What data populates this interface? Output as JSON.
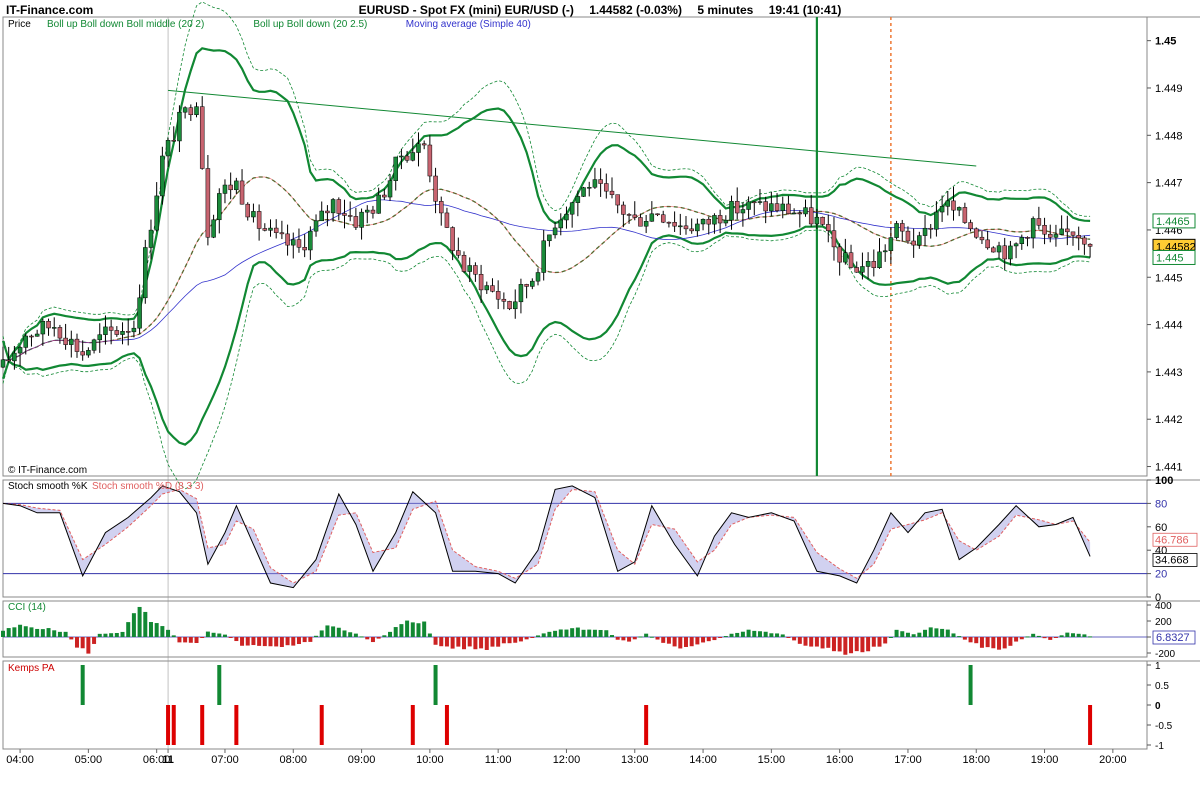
{
  "header": {
    "brand": "IT-Finance.com",
    "instrument": "EURUSD - Spot FX (mini) EUR/USD (-)",
    "price_change": "1.44582 (-0.03%)",
    "interval": "5 minutes",
    "time": "19:41 (10:41)"
  },
  "price_panel": {
    "legend": [
      {
        "text": "Price",
        "color": "#000000"
      },
      {
        "text": "Boll up Boll down Boll middle (20 2)",
        "color": "#118833"
      },
      {
        "text": "Boll up Boll down (20 2.5)",
        "color": "#118833"
      },
      {
        "text": "Moving average (Simple 40)",
        "color": "#3333cc"
      }
    ],
    "watermark": "© IT-Finance.com",
    "y_ticks": [
      "1.45",
      "1.449",
      "1.448",
      "1.447",
      "1.446",
      "1.445",
      "1.444",
      "1.443",
      "1.442",
      "1.441"
    ],
    "badges": [
      {
        "text": "1.4465",
        "color": "#118833",
        "bg": "#ffffff"
      },
      {
        "text": "1.44582",
        "color": "#000000",
        "bg": "#ffcc33"
      },
      {
        "text": "1.445",
        "color": "#118833",
        "bg": "#ffffff"
      }
    ]
  },
  "stoch_panel": {
    "legend": [
      {
        "text": "Stoch smooth %K",
        "color": "#000000"
      },
      {
        "text": "Stoch smooth %D (8 3 3)",
        "color": "#e06060"
      }
    ],
    "y_ticks": [
      "100",
      "80",
      "60",
      "40",
      "20",
      "0"
    ],
    "badges": [
      "46.786",
      "34.668"
    ]
  },
  "cci_panel": {
    "legend": [
      {
        "text": "CCI (14)",
        "color": "#118833"
      }
    ],
    "y_ticks": [
      "400",
      "200",
      "0",
      "-200"
    ],
    "badges": [
      "6.8327"
    ]
  },
  "kemps_panel": {
    "legend": [
      {
        "text": "Kemps PA",
        "color": "#cc0000"
      }
    ],
    "y_ticks": [
      "1",
      "0.5",
      "0",
      "-0.5",
      "-1"
    ]
  },
  "x_ticks": [
    "04:00",
    "05:00",
    "06:00",
    "11",
    "07:00",
    "08:00",
    "09:00",
    "10:00",
    "11:00",
    "12:00",
    "13:00",
    "14:00",
    "15:00",
    "16:00",
    "17:00",
    "18:00",
    "19:00",
    "20:00"
  ],
  "colors": {
    "bull": "#1a8a3a",
    "bear": "#c86470",
    "boll": "#118833",
    "ma": "#3333cc",
    "red_line": "#dd2222",
    "cci_up": "#118833",
    "cci_down": "#cc2222",
    "kemps_up": "#118833",
    "kemps_down": "#dd0000"
  },
  "chart_data": [
    {
      "type": "candlestick",
      "title": "Price",
      "ylim": [
        1.4408,
        1.4505
      ],
      "x_range": [
        "03:45",
        "20:30"
      ],
      "annotations": [
        {
          "type": "trendline",
          "from": [
            "06:10",
            1.44895
          ],
          "to": [
            "18:00",
            1.44735
          ]
        },
        {
          "type": "vline",
          "x": "15:40",
          "style": "solid",
          "color": "#118833"
        },
        {
          "type": "vline",
          "x": "16:45",
          "style": "dotted",
          "color": "#ee7733"
        },
        {
          "type": "vline",
          "x": "06:10",
          "style": "thin",
          "color": "#999999"
        }
      ],
      "close_path": [
        [
          "03:45",
          1.4431
        ],
        [
          "04:05",
          1.4438
        ],
        [
          "04:30",
          1.444
        ],
        [
          "04:55",
          1.4434
        ],
        [
          "05:15",
          1.4438
        ],
        [
          "05:40",
          1.444
        ],
        [
          "05:50",
          1.4455
        ],
        [
          "06:05",
          1.4475
        ],
        [
          "06:20",
          1.4483
        ],
        [
          "06:35",
          1.4488
        ],
        [
          "06:45",
          1.446
        ],
        [
          "06:55",
          1.4468
        ],
        [
          "07:10",
          1.447
        ],
        [
          "07:25",
          1.4462
        ],
        [
          "07:45",
          1.4458
        ],
        [
          "08:05",
          1.4456
        ],
        [
          "08:20",
          1.4461
        ],
        [
          "08:35",
          1.4466
        ],
        [
          "08:55",
          1.4462
        ],
        [
          "09:15",
          1.4466
        ],
        [
          "09:35",
          1.4476
        ],
        [
          "09:55",
          1.4478
        ],
        [
          "10:10",
          1.4462
        ],
        [
          "10:30",
          1.4452
        ],
        [
          "10:50",
          1.4448
        ],
        [
          "11:10",
          1.4444
        ],
        [
          "11:30",
          1.445
        ],
        [
          "11:50",
          1.4462
        ],
        [
          "12:05",
          1.4466
        ],
        [
          "12:20",
          1.447
        ],
        [
          "12:40",
          1.4466
        ],
        [
          "13:00",
          1.4462
        ],
        [
          "13:20",
          1.4464
        ],
        [
          "13:40",
          1.4461
        ],
        [
          "14:00",
          1.4461
        ],
        [
          "14:20",
          1.4464
        ],
        [
          "14:40",
          1.4465
        ],
        [
          "15:00",
          1.4465
        ],
        [
          "15:20",
          1.4464
        ],
        [
          "15:40",
          1.4462
        ],
        [
          "15:55",
          1.4456
        ],
        [
          "16:10",
          1.4452
        ],
        [
          "16:30",
          1.4453
        ],
        [
          "16:50",
          1.446
        ],
        [
          "17:10",
          1.4457
        ],
        [
          "17:30",
          1.4466
        ],
        [
          "17:50",
          1.4462
        ],
        [
          "18:10",
          1.4458
        ],
        [
          "18:30",
          1.4455
        ],
        [
          "18:50",
          1.4462
        ],
        [
          "19:05",
          1.4457
        ],
        [
          "19:25",
          1.446
        ],
        [
          "19:40",
          1.44582
        ]
      ],
      "series": [
        {
          "name": "Boll up",
          "style": "thick"
        },
        {
          "name": "Boll down",
          "style": "thick"
        },
        {
          "name": "Boll middle",
          "style": "dashed"
        },
        {
          "name": "Moving average (Simple 40)",
          "style": "thin"
        }
      ]
    },
    {
      "type": "line",
      "title": "Stoch smooth %K / %D (8 3 3)",
      "ylim": [
        0,
        100
      ],
      "reference_lines": [
        80,
        20
      ],
      "series": [
        {
          "name": "Stoch smooth %K",
          "points": [
            [
              "03:45",
              80
            ],
            [
              "04:00",
              78
            ],
            [
              "04:15",
              72
            ],
            [
              "04:35",
              72
            ],
            [
              "04:55",
              18
            ],
            [
              "05:15",
              55
            ],
            [
              "05:35",
              68
            ],
            [
              "05:55",
              85
            ],
            [
              "06:05",
              95
            ],
            [
              "06:20",
              90
            ],
            [
              "06:35",
              72
            ],
            [
              "06:45",
              28
            ],
            [
              "07:00",
              55
            ],
            [
              "07:10",
              78
            ],
            [
              "07:25",
              45
            ],
            [
              "07:40",
              12
            ],
            [
              "08:00",
              8
            ],
            [
              "08:20",
              32
            ],
            [
              "08:40",
              88
            ],
            [
              "08:55",
              62
            ],
            [
              "09:10",
              22
            ],
            [
              "09:30",
              55
            ],
            [
              "09:45",
              90
            ],
            [
              "10:05",
              72
            ],
            [
              "10:20",
              22
            ],
            [
              "10:40",
              22
            ],
            [
              "11:00",
              20
            ],
            [
              "11:15",
              12
            ],
            [
              "11:35",
              40
            ],
            [
              "11:50",
              92
            ],
            [
              "12:05",
              95
            ],
            [
              "12:25",
              85
            ],
            [
              "12:45",
              22
            ],
            [
              "13:00",
              30
            ],
            [
              "13:15",
              78
            ],
            [
              "13:35",
              45
            ],
            [
              "13:55",
              18
            ],
            [
              "14:10",
              52
            ],
            [
              "14:25",
              72
            ],
            [
              "14:40",
              68
            ],
            [
              "15:00",
              72
            ],
            [
              "15:20",
              65
            ],
            [
              "15:40",
              22
            ],
            [
              "16:00",
              18
            ],
            [
              "16:15",
              12
            ],
            [
              "16:30",
              40
            ],
            [
              "16:45",
              72
            ],
            [
              "17:00",
              55
            ],
            [
              "17:15",
              72
            ],
            [
              "17:30",
              75
            ],
            [
              "17:45",
              32
            ],
            [
              "18:00",
              42
            ],
            [
              "18:20",
              62
            ],
            [
              "18:35",
              78
            ],
            [
              "18:55",
              60
            ],
            [
              "19:10",
              62
            ],
            [
              "19:25",
              68
            ],
            [
              "19:40",
              34.668
            ]
          ]
        },
        {
          "name": "Stoch smooth %D",
          "points": [
            [
              "03:45",
              80
            ],
            [
              "04:00",
              79
            ],
            [
              "04:15",
              76
            ],
            [
              "04:35",
              74
            ],
            [
              "04:55",
              32
            ],
            [
              "05:15",
              45
            ],
            [
              "05:35",
              60
            ],
            [
              "05:55",
              78
            ],
            [
              "06:05",
              88
            ],
            [
              "06:20",
              92
            ],
            [
              "06:35",
              84
            ],
            [
              "06:45",
              42
            ],
            [
              "07:00",
              45
            ],
            [
              "07:10",
              65
            ],
            [
              "07:25",
              58
            ],
            [
              "07:40",
              25
            ],
            [
              "08:00",
              12
            ],
            [
              "08:20",
              22
            ],
            [
              "08:40",
              70
            ],
            [
              "08:55",
              72
            ],
            [
              "09:10",
              38
            ],
            [
              "09:30",
              42
            ],
            [
              "09:45",
              75
            ],
            [
              "10:05",
              82
            ],
            [
              "10:20",
              40
            ],
            [
              "10:40",
              26
            ],
            [
              "11:00",
              22
            ],
            [
              "11:15",
              16
            ],
            [
              "11:35",
              28
            ],
            [
              "11:50",
              75
            ],
            [
              "12:05",
              92
            ],
            [
              "12:25",
              90
            ],
            [
              "12:45",
              40
            ],
            [
              "13:00",
              28
            ],
            [
              "13:15",
              62
            ],
            [
              "13:35",
              58
            ],
            [
              "13:55",
              30
            ],
            [
              "14:10",
              40
            ],
            [
              "14:25",
              62
            ],
            [
              "14:40",
              68
            ],
            [
              "15:00",
              70
            ],
            [
              "15:20",
              68
            ],
            [
              "15:40",
              38
            ],
            [
              "16:00",
              24
            ],
            [
              "16:15",
              16
            ],
            [
              "16:30",
              28
            ],
            [
              "16:45",
              58
            ],
            [
              "17:00",
              62
            ],
            [
              "17:15",
              66
            ],
            [
              "17:30",
              72
            ],
            [
              "17:45",
              48
            ],
            [
              "18:00",
              40
            ],
            [
              "18:20",
              52
            ],
            [
              "18:35",
              70
            ],
            [
              "18:55",
              66
            ],
            [
              "19:10",
              62
            ],
            [
              "19:25",
              65
            ],
            [
              "19:40",
              46.786
            ]
          ]
        }
      ]
    },
    {
      "type": "bar",
      "title": "CCI (14)",
      "ylim": [
        -250,
        450
      ],
      "segments": [
        [
          "03:45",
          80
        ],
        [
          "04:00",
          140
        ],
        [
          "04:20",
          110
        ],
        [
          "04:40",
          60
        ],
        [
          "04:50",
          -120
        ],
        [
          "05:00",
          -200
        ],
        [
          "05:10",
          40
        ],
        [
          "05:30",
          60
        ],
        [
          "05:45",
          380
        ],
        [
          "05:55",
          180
        ],
        [
          "06:10",
          100
        ],
        [
          "06:20",
          -60
        ],
        [
          "06:35",
          -70
        ],
        [
          "06:45",
          60
        ],
        [
          "07:00",
          30
        ],
        [
          "07:15",
          -100
        ],
        [
          "07:35",
          -120
        ],
        [
          "07:55",
          -110
        ],
        [
          "08:15",
          -60
        ],
        [
          "08:30",
          160
        ],
        [
          "08:40",
          120
        ],
        [
          "08:55",
          40
        ],
        [
          "09:10",
          -60
        ],
        [
          "09:25",
          60
        ],
        [
          "09:40",
          220
        ],
        [
          "09:55",
          180
        ],
        [
          "10:05",
          -100
        ],
        [
          "10:20",
          -140
        ],
        [
          "10:35",
          -130
        ],
        [
          "10:50",
          -160
        ],
        [
          "11:05",
          -90
        ],
        [
          "11:20",
          -60
        ],
        [
          "11:35",
          20
        ],
        [
          "11:50",
          90
        ],
        [
          "12:05",
          110
        ],
        [
          "12:20",
          100
        ],
        [
          "12:35",
          80
        ],
        [
          "12:45",
          -30
        ],
        [
          "12:55",
          -60
        ],
        [
          "13:10",
          40
        ],
        [
          "13:25",
          -70
        ],
        [
          "13:40",
          -130
        ],
        [
          "13:55",
          -90
        ],
        [
          "14:10",
          -40
        ],
        [
          "14:25",
          40
        ],
        [
          "14:40",
          90
        ],
        [
          "14:55",
          60
        ],
        [
          "15:10",
          30
        ],
        [
          "15:25",
          -80
        ],
        [
          "15:40",
          -130
        ],
        [
          "15:55",
          -170
        ],
        [
          "16:10",
          -210
        ],
        [
          "16:25",
          -160
        ],
        [
          "16:40",
          -80
        ],
        [
          "16:50",
          80
        ],
        [
          "17:05",
          40
        ],
        [
          "17:20",
          110
        ],
        [
          "17:35",
          90
        ],
        [
          "17:50",
          -30
        ],
        [
          "18:05",
          -120
        ],
        [
          "18:20",
          -170
        ],
        [
          "18:35",
          -60
        ],
        [
          "18:50",
          40
        ],
        [
          "19:05",
          -40
        ],
        [
          "19:20",
          50
        ],
        [
          "19:35",
          30
        ],
        [
          "19:40",
          6.8327
        ]
      ]
    },
    {
      "type": "bar",
      "title": "Kemps PA",
      "ylim": [
        -1,
        1
      ],
      "bars": [
        {
          "x": "04:55",
          "value": 1
        },
        {
          "x": "06:10",
          "value": -1
        },
        {
          "x": "06:15",
          "value": -1
        },
        {
          "x": "06:40",
          "value": -1
        },
        {
          "x": "06:55",
          "value": 1
        },
        {
          "x": "07:10",
          "value": -1
        },
        {
          "x": "08:25",
          "value": -1
        },
        {
          "x": "09:45",
          "value": -1
        },
        {
          "x": "10:05",
          "value": 1
        },
        {
          "x": "10:15",
          "value": -1
        },
        {
          "x": "13:10",
          "value": -1
        },
        {
          "x": "17:55",
          "value": 1
        },
        {
          "x": "19:40",
          "value": -1
        }
      ]
    }
  ]
}
